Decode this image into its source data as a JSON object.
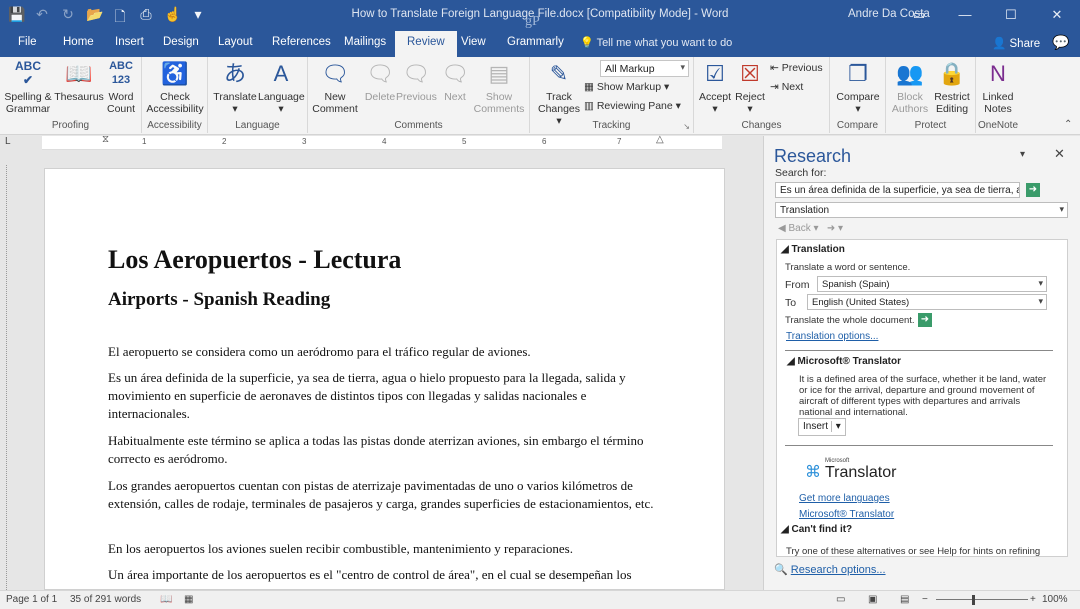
{
  "window": {
    "title": "How to Translate Foreign Language File.docx [Compatibility Mode]  -  Word",
    "user": "Andre Da Costa",
    "watermark": "gP"
  },
  "tabs": [
    "File",
    "Home",
    "Insert",
    "Design",
    "Layout",
    "References",
    "Mailings",
    "Review",
    "View",
    "Grammarly"
  ],
  "active_tab": "Review",
  "tell_me": "Tell me what you want to do",
  "share": "Share",
  "ribbon": {
    "proofing": {
      "label": "Proofing",
      "spelling1": "Spelling &",
      "spelling2": "Grammar",
      "thesaurus": "Thesaurus",
      "wc1": "Word",
      "wc2": "Count"
    },
    "accessibility": {
      "label": "Accessibility",
      "check1": "Check",
      "check2": "Accessibility"
    },
    "language": {
      "label": "Language",
      "translate": "Translate",
      "language": "Language"
    },
    "comments": {
      "label": "Comments",
      "new1": "New",
      "new2": "Comment",
      "delete": "Delete",
      "previous": "Previous",
      "next": "Next",
      "show1": "Show",
      "show2": "Comments"
    },
    "tracking": {
      "label": "Tracking",
      "track1": "Track",
      "track2": "Changes",
      "markup": "All Markup",
      "show_markup": "Show Markup",
      "reviewing_pane": "Reviewing Pane"
    },
    "changes": {
      "label": "Changes",
      "accept": "Accept",
      "reject": "Reject",
      "previous": "Previous",
      "next": "Next"
    },
    "compare": {
      "label": "Compare",
      "compare": "Compare"
    },
    "protect": {
      "label": "Protect",
      "block1": "Block",
      "block2": "Authors",
      "restrict1": "Restrict",
      "restrict2": "Editing"
    },
    "onenote": {
      "label": "OneNote",
      "linked1": "Linked",
      "linked2": "Notes"
    }
  },
  "ruler_numbers": [
    "1",
    "2",
    "3",
    "4",
    "5",
    "6",
    "7"
  ],
  "document": {
    "title": "Los Aeropuertos - Lectura",
    "subtitle": "Airports - Spanish Reading",
    "paragraphs": [
      "El aeropuerto se considera como un aeródromo para el tráfico regular de aviones.",
      "Es un área definida de la superficie, ya sea de tierra, agua o hielo propuesto para la llegada, salida y movimiento en superficie de aeronaves de distintos tipos con llegadas y salidas nacionales e internacionales.",
      "Habitualmente este término se aplica a todas las pistas donde aterrizan aviones, sin embargo el término correcto es aeródromo.",
      "Los grandes aeropuertos cuentan con pistas de aterrizaje pavimentadas de uno o varios kilómetros de extensión, calles de rodaje, terminales de pasajeros y carga, grandes superficies de estacionamientos, etc.",
      "En los aeropuertos los aviones suelen recibir combustible, mantenimiento y reparaciones.",
      "Un área importante de los aeropuertos es el \"centro de control de área\", en el cual se desempeñan los"
    ]
  },
  "research": {
    "title": "Research",
    "search_for_label": "Search for:",
    "search_value": "Es un área definida de la superficie, ya sea de tierra, agua o hielo",
    "service": "Translation",
    "back": "Back",
    "section_translation": "Translation",
    "translate_hint": "Translate a word or sentence.",
    "from_label": "From",
    "from_value": "Spanish (Spain)",
    "to_label": "To",
    "to_value": "English (United States)",
    "whole_doc": "Translate the whole document.",
    "translation_options": "Translation options...",
    "section_ms": "Microsoft® Translator",
    "translation_text": "It is a defined area of the surface, whether it be land, water or ice for the arrival, departure and ground movement of aircraft of different types with departures and arrivals national and international.",
    "insert": "Insert",
    "brand_small": "Microsoft",
    "brand": "Translator",
    "get_more": "Get more languages",
    "ms_link": "Microsoft® Translator",
    "cant_find": "Can't find it?",
    "try_text": "Try one of these alternatives or see Help for hints on refining",
    "research_options": "Research options..."
  },
  "status": {
    "page": "Page 1 of 1",
    "words": "35 of 291 words",
    "zoom": "100%"
  }
}
